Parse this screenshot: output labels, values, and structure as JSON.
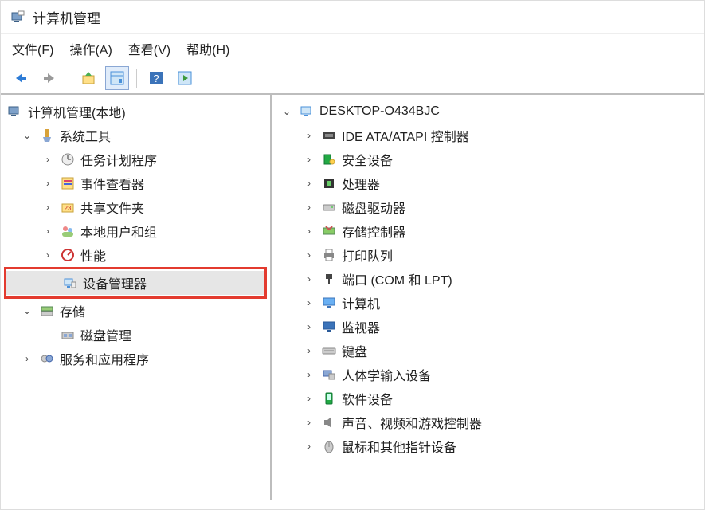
{
  "window": {
    "title": "计算机管理"
  },
  "menu": {
    "file": "文件(F)",
    "action": "操作(A)",
    "view": "查看(V)",
    "help": "帮助(H)"
  },
  "left_tree": {
    "root": "计算机管理(本地)",
    "system_tools": "系统工具",
    "task_scheduler": "任务计划程序",
    "event_viewer": "事件查看器",
    "shared_folders": "共享文件夹",
    "local_users": "本地用户和组",
    "performance": "性能",
    "device_manager": "设备管理器",
    "storage": "存储",
    "disk_mgmt": "磁盘管理",
    "services_apps": "服务和应用程序"
  },
  "right_tree": {
    "computer_name": "DESKTOP-O434BJC",
    "ide": "IDE ATA/ATAPI 控制器",
    "security": "安全设备",
    "cpu": "处理器",
    "disk_drives": "磁盘驱动器",
    "storage_ctrl": "存储控制器",
    "print_queues": "打印队列",
    "ports": "端口 (COM 和 LPT)",
    "computers": "计算机",
    "monitors": "监视器",
    "keyboards": "键盘",
    "hid": "人体学输入设备",
    "software_devices": "软件设备",
    "sound": "声音、视频和游戏控制器",
    "mouse": "鼠标和其他指针设备"
  }
}
